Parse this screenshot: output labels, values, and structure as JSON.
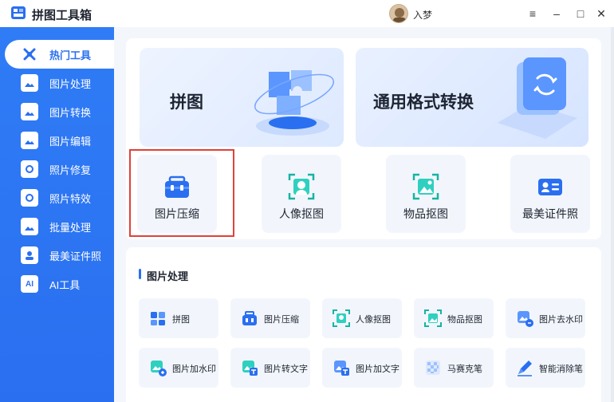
{
  "app": {
    "title": "拼图工具箱"
  },
  "user": {
    "name": "入梦"
  },
  "window_controls": {
    "menu": "≡",
    "minimize": "–",
    "maximize": "□",
    "close": "✕"
  },
  "sidebar": {
    "items": [
      {
        "label": "热门工具",
        "icon": "tools-icon",
        "active": true
      },
      {
        "label": "图片处理",
        "icon": "image-process-icon"
      },
      {
        "label": "图片转换",
        "icon": "image-convert-icon"
      },
      {
        "label": "图片编辑",
        "icon": "image-edit-icon"
      },
      {
        "label": "照片修复",
        "icon": "photo-repair-icon"
      },
      {
        "label": "照片特效",
        "icon": "photo-effect-icon"
      },
      {
        "label": "批量处理",
        "icon": "batch-icon"
      },
      {
        "label": "最美证件照",
        "icon": "id-photo-icon"
      },
      {
        "label": "AI工具",
        "icon": "ai-icon"
      }
    ]
  },
  "banners": [
    {
      "title": "拼图",
      "icon": "puzzle-illustration-icon"
    },
    {
      "title": "通用格式转换",
      "icon": "format-convert-illustration-icon"
    }
  ],
  "featured_tools": [
    {
      "label": "图片压缩",
      "icon": "compress-toolbox-icon",
      "highlighted": true
    },
    {
      "label": "人像抠图",
      "icon": "portrait-cutout-icon"
    },
    {
      "label": "物品抠图",
      "icon": "object-cutout-icon"
    },
    {
      "label": "最美证件照",
      "icon": "id-card-icon"
    }
  ],
  "image_processing": {
    "title": "图片处理",
    "items": [
      {
        "label": "拼图",
        "icon": "puzzle-icon"
      },
      {
        "label": "图片压缩",
        "icon": "compress-icon"
      },
      {
        "label": "人像抠图",
        "icon": "portrait-icon"
      },
      {
        "label": "物品抠图",
        "icon": "object-icon"
      },
      {
        "label": "图片去水印",
        "icon": "remove-watermark-icon"
      },
      {
        "label": "图片加水印",
        "icon": "add-watermark-icon"
      },
      {
        "label": "图片转文字",
        "icon": "image-to-text-icon"
      },
      {
        "label": "图片加文字",
        "icon": "add-text-icon"
      },
      {
        "label": "马赛克笔",
        "icon": "mosaic-icon"
      },
      {
        "label": "智能消除笔",
        "icon": "smart-eraser-icon"
      }
    ]
  },
  "colors": {
    "accent": "#2a6ff0",
    "highlight": "#e0413a"
  }
}
